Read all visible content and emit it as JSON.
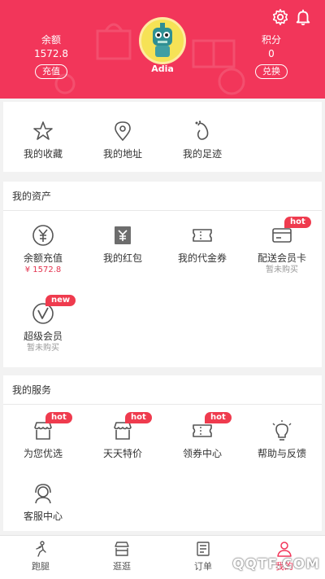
{
  "header": {
    "background_color": "#f2365a",
    "settings_icon": "gear-icon",
    "notification_icon": "bell-icon",
    "balance": {
      "label": "余额",
      "value": "1572.8",
      "button": "充值"
    },
    "user": {
      "name": "Adia"
    },
    "points": {
      "label": "积分",
      "value": "0",
      "button": "兑换"
    }
  },
  "quick_links": [
    {
      "label": "我的收藏",
      "icon": "star-icon"
    },
    {
      "label": "我的地址",
      "icon": "location-pin-icon"
    },
    {
      "label": "我的足迹",
      "icon": "footprint-icon"
    }
  ],
  "assets": {
    "title": "我的资产",
    "items": [
      {
        "label": "余额充值",
        "sub": "¥ 1572.8",
        "icon": "yen-circle-icon"
      },
      {
        "label": "我的红包",
        "icon": "red-packet-icon"
      },
      {
        "label": "我的代金券",
        "icon": "voucher-icon"
      },
      {
        "label": "配送会员卡",
        "sub": "暂未购买",
        "badge": "hot",
        "icon": "member-card-icon"
      },
      {
        "label": "超级会员",
        "sub": "暂未购买",
        "badge": "new",
        "icon": "super-vip-icon"
      }
    ]
  },
  "services": {
    "title": "我的服务",
    "items": [
      {
        "label": "为您优选",
        "badge": "hot",
        "icon": "shop-icon"
      },
      {
        "label": "天天特价",
        "badge": "hot",
        "icon": "shop-icon"
      },
      {
        "label": "领券中心",
        "badge": "hot",
        "icon": "coupon-icon"
      },
      {
        "label": "帮助与反馈",
        "icon": "lightbulb-icon"
      },
      {
        "label": "客服中心",
        "icon": "customer-service-icon"
      }
    ]
  },
  "tabbar": {
    "active_color": "#f2365a",
    "items": [
      {
        "label": "跑腿",
        "icon": "runner-icon"
      },
      {
        "label": "逛逛",
        "icon": "store-icon"
      },
      {
        "label": "订单",
        "icon": "order-list-icon"
      },
      {
        "label": "我的",
        "icon": "person-icon",
        "active": true
      }
    ]
  },
  "watermark": "QQTF.COM"
}
